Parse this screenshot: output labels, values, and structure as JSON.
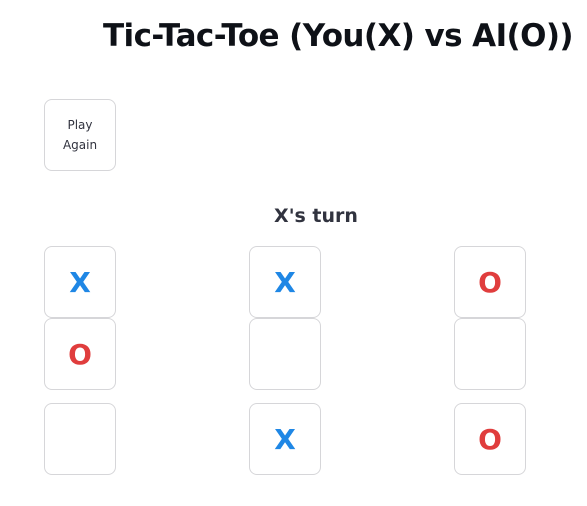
{
  "title": "Tic-Tac-Toe (You(X) vs AI(O))",
  "restart_label": "Play Again",
  "status": "X's turn",
  "board": [
    [
      "X",
      "X",
      "O"
    ],
    [
      "O",
      "",
      ""
    ],
    [
      "",
      "X",
      "O"
    ]
  ],
  "colors": {
    "X": "#1f87e5",
    "O": "#e03d3d"
  }
}
